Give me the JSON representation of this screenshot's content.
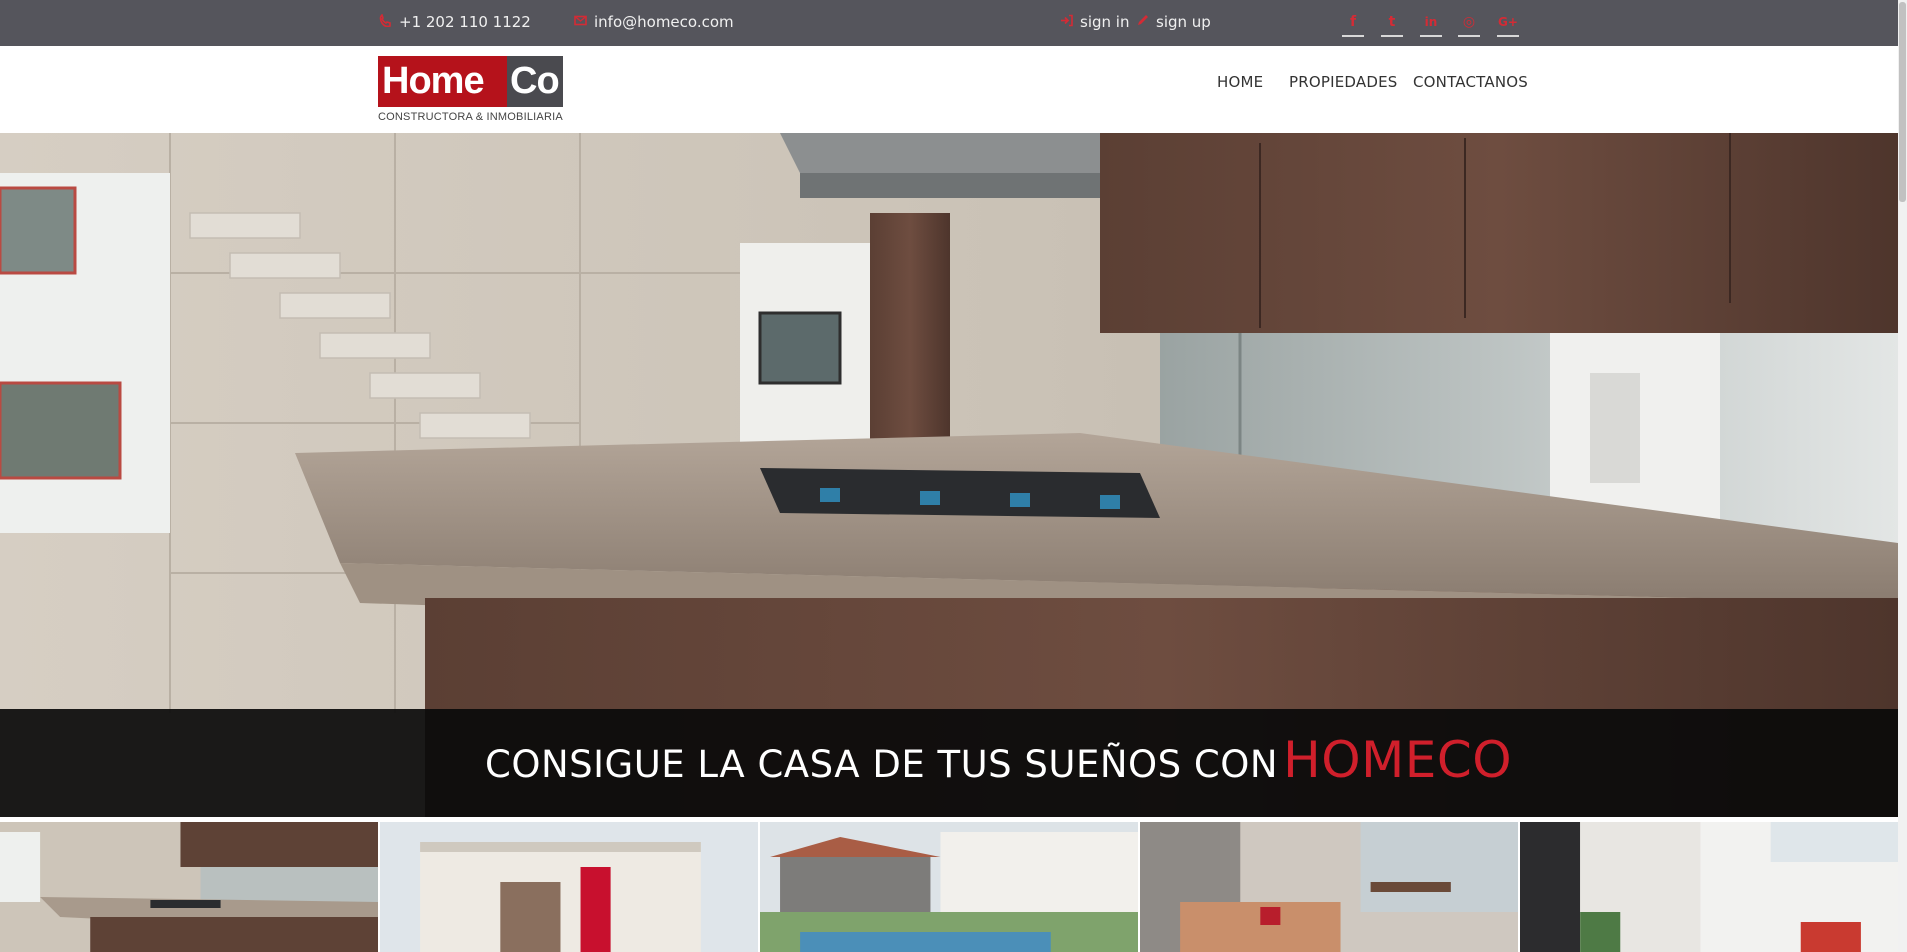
{
  "topbar": {
    "phone": "+1 202 110 1122",
    "email": "info@homeco.com",
    "signin": "sign in",
    "signup": "sign up",
    "social": [
      {
        "icon": "facebook-icon",
        "glyph": "f"
      },
      {
        "icon": "twitter-icon",
        "glyph": "t"
      },
      {
        "icon": "linkedin-icon",
        "glyph": "in"
      },
      {
        "icon": "dribbble-icon",
        "glyph": "◎"
      },
      {
        "icon": "google-plus-icon",
        "glyph": "G+"
      }
    ]
  },
  "logo": {
    "home": "Home",
    "co": "Co",
    "sub": "CONSTRUCTORA & INMOBILIARIA"
  },
  "nav": {
    "items": [
      "HOME",
      "PROPIEDADES",
      "CONTACTANOS"
    ]
  },
  "hero": {
    "caption": "CONSIGUE LA CASA DE TUS SUEÑOS CON",
    "brand": "HOMECO"
  },
  "colors": {
    "accent": "#d01f2b",
    "topbar": "#55555c",
    "logo_red": "#b5121b",
    "logo_gray": "#4a4a4f"
  }
}
